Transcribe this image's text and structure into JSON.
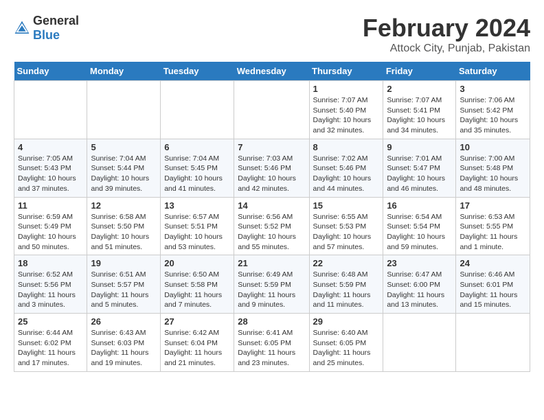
{
  "header": {
    "logo_general": "General",
    "logo_blue": "Blue",
    "month_title": "February 2024",
    "location": "Attock City, Punjab, Pakistan"
  },
  "columns": [
    "Sunday",
    "Monday",
    "Tuesday",
    "Wednesday",
    "Thursday",
    "Friday",
    "Saturday"
  ],
  "weeks": [
    [
      {
        "day": "",
        "info": ""
      },
      {
        "day": "",
        "info": ""
      },
      {
        "day": "",
        "info": ""
      },
      {
        "day": "",
        "info": ""
      },
      {
        "day": "1",
        "info": "Sunrise: 7:07 AM\nSunset: 5:40 PM\nDaylight: 10 hours\nand 32 minutes."
      },
      {
        "day": "2",
        "info": "Sunrise: 7:07 AM\nSunset: 5:41 PM\nDaylight: 10 hours\nand 34 minutes."
      },
      {
        "day": "3",
        "info": "Sunrise: 7:06 AM\nSunset: 5:42 PM\nDaylight: 10 hours\nand 35 minutes."
      }
    ],
    [
      {
        "day": "4",
        "info": "Sunrise: 7:05 AM\nSunset: 5:43 PM\nDaylight: 10 hours\nand 37 minutes."
      },
      {
        "day": "5",
        "info": "Sunrise: 7:04 AM\nSunset: 5:44 PM\nDaylight: 10 hours\nand 39 minutes."
      },
      {
        "day": "6",
        "info": "Sunrise: 7:04 AM\nSunset: 5:45 PM\nDaylight: 10 hours\nand 41 minutes."
      },
      {
        "day": "7",
        "info": "Sunrise: 7:03 AM\nSunset: 5:46 PM\nDaylight: 10 hours\nand 42 minutes."
      },
      {
        "day": "8",
        "info": "Sunrise: 7:02 AM\nSunset: 5:46 PM\nDaylight: 10 hours\nand 44 minutes."
      },
      {
        "day": "9",
        "info": "Sunrise: 7:01 AM\nSunset: 5:47 PM\nDaylight: 10 hours\nand 46 minutes."
      },
      {
        "day": "10",
        "info": "Sunrise: 7:00 AM\nSunset: 5:48 PM\nDaylight: 10 hours\nand 48 minutes."
      }
    ],
    [
      {
        "day": "11",
        "info": "Sunrise: 6:59 AM\nSunset: 5:49 PM\nDaylight: 10 hours\nand 50 minutes."
      },
      {
        "day": "12",
        "info": "Sunrise: 6:58 AM\nSunset: 5:50 PM\nDaylight: 10 hours\nand 51 minutes."
      },
      {
        "day": "13",
        "info": "Sunrise: 6:57 AM\nSunset: 5:51 PM\nDaylight: 10 hours\nand 53 minutes."
      },
      {
        "day": "14",
        "info": "Sunrise: 6:56 AM\nSunset: 5:52 PM\nDaylight: 10 hours\nand 55 minutes."
      },
      {
        "day": "15",
        "info": "Sunrise: 6:55 AM\nSunset: 5:53 PM\nDaylight: 10 hours\nand 57 minutes."
      },
      {
        "day": "16",
        "info": "Sunrise: 6:54 AM\nSunset: 5:54 PM\nDaylight: 10 hours\nand 59 minutes."
      },
      {
        "day": "17",
        "info": "Sunrise: 6:53 AM\nSunset: 5:55 PM\nDaylight: 11 hours\nand 1 minute."
      }
    ],
    [
      {
        "day": "18",
        "info": "Sunrise: 6:52 AM\nSunset: 5:56 PM\nDaylight: 11 hours\nand 3 minutes."
      },
      {
        "day": "19",
        "info": "Sunrise: 6:51 AM\nSunset: 5:57 PM\nDaylight: 11 hours\nand 5 minutes."
      },
      {
        "day": "20",
        "info": "Sunrise: 6:50 AM\nSunset: 5:58 PM\nDaylight: 11 hours\nand 7 minutes."
      },
      {
        "day": "21",
        "info": "Sunrise: 6:49 AM\nSunset: 5:59 PM\nDaylight: 11 hours\nand 9 minutes."
      },
      {
        "day": "22",
        "info": "Sunrise: 6:48 AM\nSunset: 5:59 PM\nDaylight: 11 hours\nand 11 minutes."
      },
      {
        "day": "23",
        "info": "Sunrise: 6:47 AM\nSunset: 6:00 PM\nDaylight: 11 hours\nand 13 minutes."
      },
      {
        "day": "24",
        "info": "Sunrise: 6:46 AM\nSunset: 6:01 PM\nDaylight: 11 hours\nand 15 minutes."
      }
    ],
    [
      {
        "day": "25",
        "info": "Sunrise: 6:44 AM\nSunset: 6:02 PM\nDaylight: 11 hours\nand 17 minutes."
      },
      {
        "day": "26",
        "info": "Sunrise: 6:43 AM\nSunset: 6:03 PM\nDaylight: 11 hours\nand 19 minutes."
      },
      {
        "day": "27",
        "info": "Sunrise: 6:42 AM\nSunset: 6:04 PM\nDaylight: 11 hours\nand 21 minutes."
      },
      {
        "day": "28",
        "info": "Sunrise: 6:41 AM\nSunset: 6:05 PM\nDaylight: 11 hours\nand 23 minutes."
      },
      {
        "day": "29",
        "info": "Sunrise: 6:40 AM\nSunset: 6:05 PM\nDaylight: 11 hours\nand 25 minutes."
      },
      {
        "day": "",
        "info": ""
      },
      {
        "day": "",
        "info": ""
      }
    ]
  ]
}
